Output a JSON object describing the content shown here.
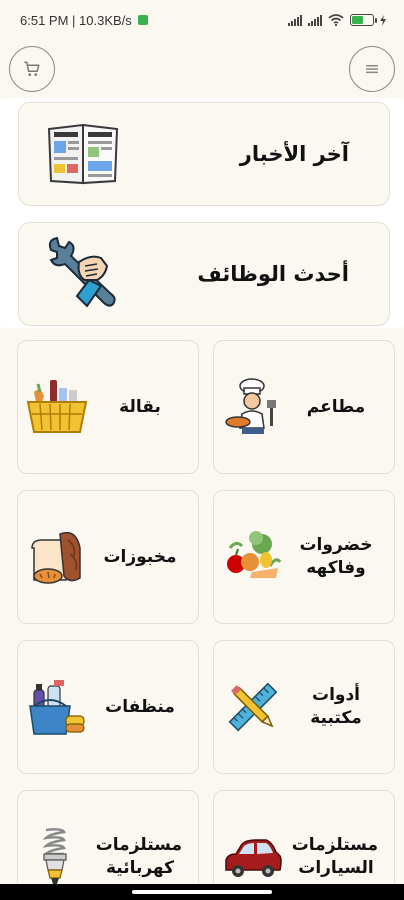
{
  "status": {
    "time_speed": "6:51 PM | 10.3KB/s",
    "battery_level": 0.55,
    "battery_color": "#37b24d"
  },
  "topbar": {
    "cart_icon": "cart-icon",
    "menu_icon": "menu-icon"
  },
  "features": [
    {
      "title": "آخر الأخبار",
      "icon": "newspaper-icon"
    },
    {
      "title": "أحدث الوظائف",
      "icon": "wrench-hand-icon"
    }
  ],
  "categories": [
    {
      "label": "مطاعم",
      "icon": "chef-icon"
    },
    {
      "label": "بقالة",
      "icon": "grocery-basket-icon"
    },
    {
      "label": "خضروات وفاكهه",
      "icon": "vegetables-icon"
    },
    {
      "label": "مخبوزات",
      "icon": "bread-icon"
    },
    {
      "label": "أدوات مكتبية",
      "icon": "ruler-pencil-icon"
    },
    {
      "label": "منظفات",
      "icon": "cleaning-supplies-icon"
    },
    {
      "label": "مستلزمات السيارات",
      "icon": "car-icon"
    },
    {
      "label": "مستلزمات كهربائية",
      "icon": "light-bulb-icon"
    }
  ]
}
